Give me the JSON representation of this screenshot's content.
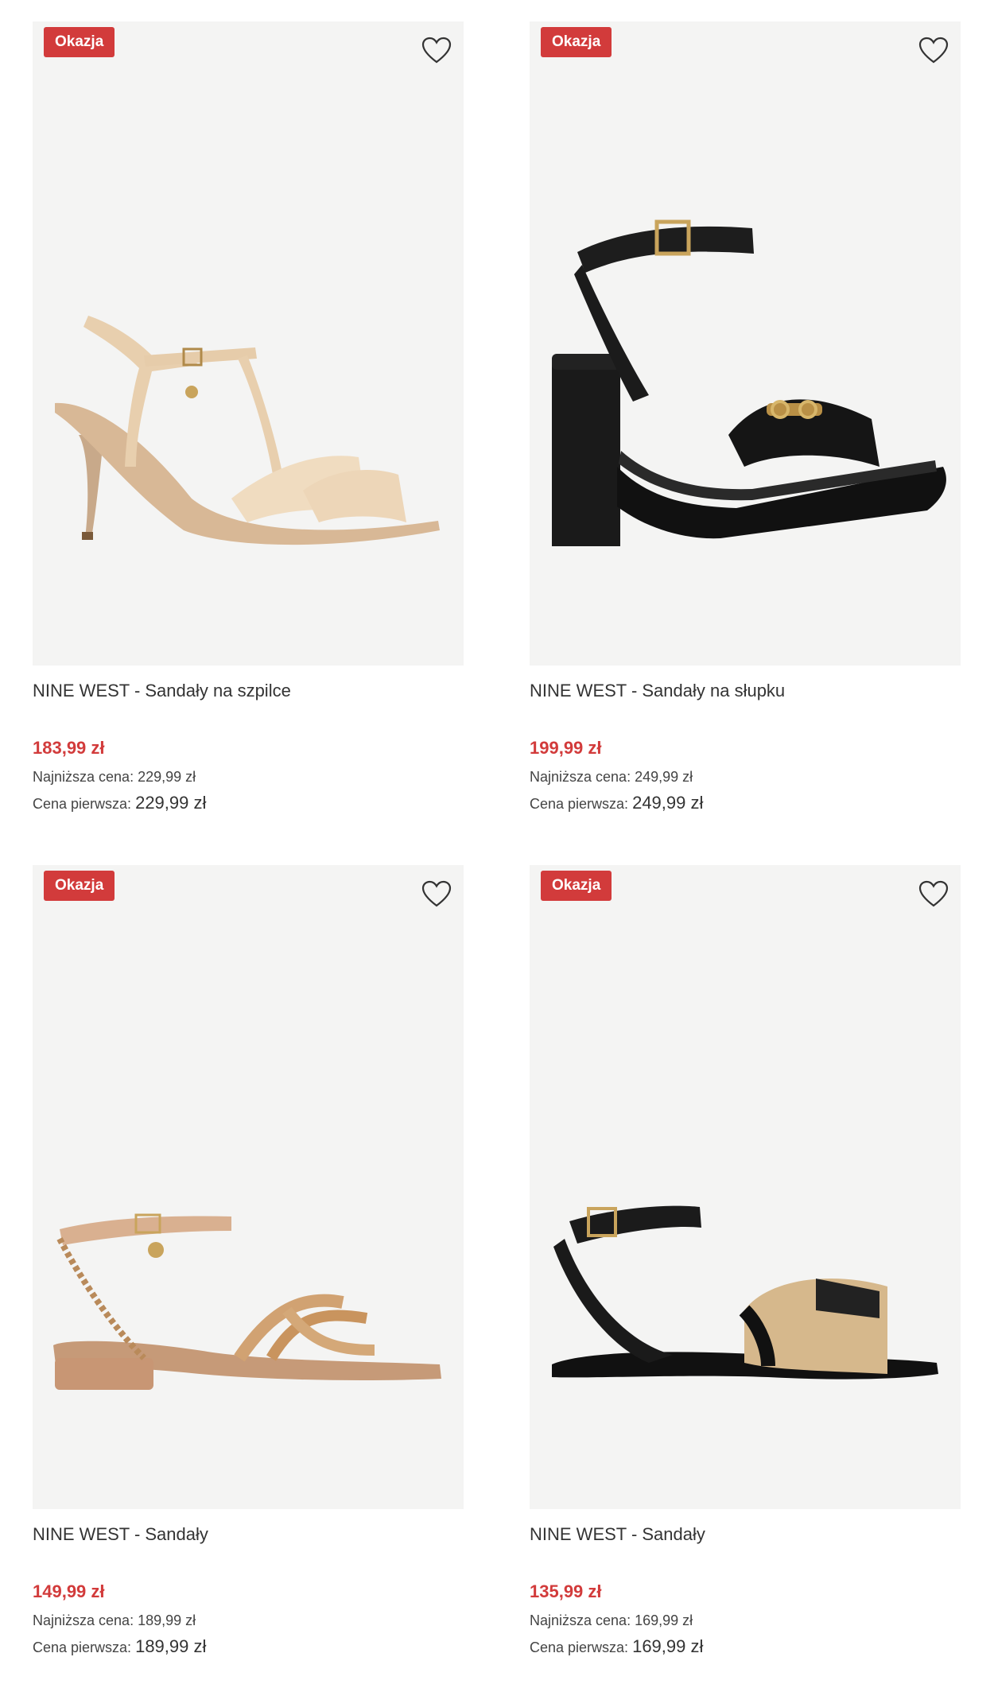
{
  "badge_label": "Okazja",
  "currency_color": "#d23b3b",
  "products": [
    {
      "badge": "Okazja",
      "title": "NINE WEST - Sandały na szpilce",
      "price": "183,99 zł",
      "lowest_label": "Najniższa cena:",
      "lowest_value": "229,99 zł",
      "first_label": "Cena pierwsza:",
      "first_value": "229,99 zł",
      "icon": "heart-outline"
    },
    {
      "badge": "Okazja",
      "title": "NINE WEST - Sandały na słupku",
      "price": "199,99 zł",
      "lowest_label": "Najniższa cena:",
      "lowest_value": "249,99 zł",
      "first_label": "Cena pierwsza:",
      "first_value": "249,99 zł",
      "icon": "heart-outline"
    },
    {
      "badge": "Okazja",
      "title": "NINE WEST - Sandały",
      "price": "149,99 zł",
      "lowest_label": "Najniższa cena:",
      "lowest_value": "189,99 zł",
      "first_label": "Cena pierwsza:",
      "first_value": "189,99 zł",
      "icon": "heart-outline"
    },
    {
      "badge": "Okazja",
      "title": "NINE WEST - Sandały",
      "price": "135,99 zł",
      "lowest_label": "Najniższa cena:",
      "lowest_value": "169,99 zł",
      "first_label": "Cena pierwsza:",
      "first_value": "169,99 zł",
      "icon": "heart-outline"
    }
  ]
}
